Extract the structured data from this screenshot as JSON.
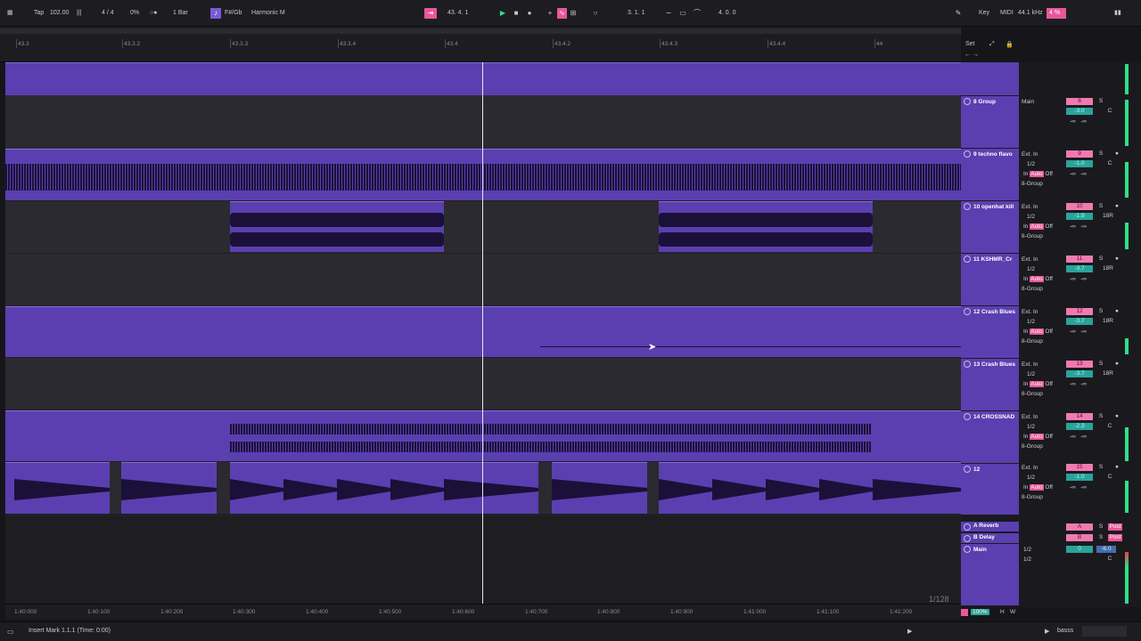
{
  "topbar": {
    "tap": "Tap",
    "tempo": "102.00",
    "signature": "4 / 4",
    "swing": "0%",
    "quantize": "1 Bar",
    "key": "F#/Gb",
    "scale": "Harmonic M",
    "position": "43.  4.  1",
    "loop_start": "3.  1.  1",
    "loop_length": "4.  0.  0",
    "key_label": "Key",
    "midi_label": "MIDI",
    "sample_rate": "44.1 kHz",
    "cpu": "4 %"
  },
  "ruler": {
    "bars": [
      "43.3",
      "43.3.2",
      "43.3.3",
      "43.3.4",
      "43.4",
      "43.4.2",
      "43.4.3",
      "43.4.4",
      "44"
    ],
    "set_label": "Set"
  },
  "tracks": [
    {
      "name": "8 Group",
      "input": "Main",
      "number": "8",
      "volume": "-3.0",
      "pan": "C",
      "a": "-∞",
      "b": "-∞"
    },
    {
      "name": "9 techno flavo",
      "input": "Ext. In",
      "channel": "1/2",
      "monitor_in": "In",
      "monitor_auto": "Auto",
      "monitor_off": "Off",
      "output": "8-Group",
      "number": "9",
      "volume": "-1.0",
      "pan": "C",
      "a": "-∞",
      "b": "-∞"
    },
    {
      "name": "10 openhat kill",
      "input": "Ext. In",
      "channel": "1/2",
      "monitor_in": "In",
      "monitor_auto": "Auto",
      "monitor_off": "Off",
      "output": "8-Group",
      "number": "10",
      "volume": "-1.9",
      "pan": "18R",
      "a": "-∞",
      "b": "-∞"
    },
    {
      "name": "11 KSHMR_Cr",
      "input": "Ext. In",
      "channel": "1/2",
      "monitor_in": "In",
      "monitor_auto": "Auto",
      "monitor_off": "Off",
      "output": "8-Group",
      "number": "11",
      "volume": "-3.7",
      "pan": "18R",
      "a": "-∞",
      "b": "-∞"
    },
    {
      "name": "12 Crash Blues",
      "input": "Ext. In",
      "channel": "1/2",
      "monitor_in": "In",
      "monitor_auto": "Auto",
      "monitor_off": "Off",
      "output": "8-Group",
      "number": "12",
      "volume": "-3.7",
      "pan": "18R",
      "a": "-∞",
      "b": "-∞"
    },
    {
      "name": "13 Crash Blues",
      "input": "Ext. In",
      "channel": "1/2",
      "monitor_in": "In",
      "monitor_auto": "Auto",
      "monitor_off": "Off",
      "output": "8-Group",
      "number": "13",
      "volume": "-3.7",
      "pan": "18R",
      "a": "-∞",
      "b": "-∞"
    },
    {
      "name": "14 CROSSNAD",
      "input": "Ext. In",
      "channel": "1/2",
      "monitor_in": "In",
      "monitor_auto": "Auto",
      "monitor_off": "Off",
      "output": "8-Group",
      "number": "14",
      "volume": "-2.3",
      "pan": "C",
      "a": "-∞",
      "b": "-∞"
    },
    {
      "name": "12",
      "input": "Ext. In",
      "channel": "1/2",
      "monitor_in": "In",
      "monitor_auto": "Auto",
      "monitor_off": "Off",
      "output": "8-Group",
      "number": "15",
      "volume": "-1.0",
      "pan": "C",
      "a": "-∞",
      "b": "-∞"
    }
  ],
  "returns": [
    {
      "name": "A Reverb",
      "letter": "A",
      "solo": "S",
      "post": "Post"
    },
    {
      "name": "B Delay",
      "letter": "B",
      "solo": "S",
      "post": "Post"
    }
  ],
  "main": {
    "name": "Main",
    "ch1": "1/2",
    "ch2": "1/2",
    "volume": "0",
    "send": "-6.0",
    "pan": "C"
  },
  "timeline": [
    "1:40:000",
    "1:40:100",
    "1:40:200",
    "1:40:300",
    "1:40:400",
    "1:40:500",
    "1:40:600",
    "1:40:700",
    "1:40:800",
    "1:40:900",
    "1:41:000",
    "1:41:100",
    "1:41:200"
  ],
  "zoom_label": "1/128",
  "status": {
    "message": "Insert Mark 1.1.1 (Time: 0:00)",
    "track": "basss",
    "zoom": "100%",
    "h": "H",
    "w": "W",
    "solo_label": "S"
  },
  "colors": {
    "clip": "#5b3fb0",
    "pink": "#e8579a",
    "teal": "#2aa39a",
    "meter": "#2ee08a"
  }
}
